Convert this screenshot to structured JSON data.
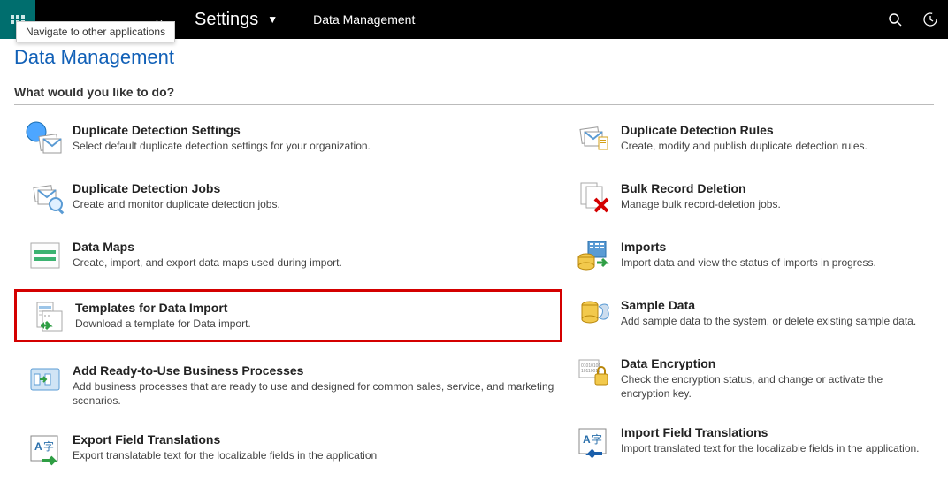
{
  "nav": {
    "tooltip": "Navigate to other applications",
    "settings": "Settings",
    "breadcrumb": "Data Management"
  },
  "page": {
    "title": "Data Management",
    "prompt": "What would you like to do?"
  },
  "left": [
    {
      "title": "Duplicate Detection Settings",
      "desc": "Select default duplicate detection settings for your organization."
    },
    {
      "title": "Duplicate Detection Jobs",
      "desc": "Create and monitor duplicate detection jobs."
    },
    {
      "title": "Data Maps",
      "desc": "Create, import, and export data maps used during import."
    },
    {
      "title": "Templates for Data Import",
      "desc": "Download a template for Data import.",
      "highlight": true
    },
    {
      "title": "Add Ready-to-Use Business Processes",
      "desc": "Add business processes that are ready to use and designed for common sales, service, and marketing scenarios."
    },
    {
      "title": "Export Field Translations",
      "desc": "Export translatable text for the localizable fields in the application"
    }
  ],
  "right": [
    {
      "title": "Duplicate Detection Rules",
      "desc": "Create, modify and publish duplicate detection rules."
    },
    {
      "title": "Bulk Record Deletion",
      "desc": "Manage bulk record-deletion jobs."
    },
    {
      "title": "Imports",
      "desc": "Import data and view the status of imports in progress."
    },
    {
      "title": "Sample Data",
      "desc": "Add sample data to the system, or delete existing sample data."
    },
    {
      "title": "Data Encryption",
      "desc": "Check the encryption status, and change or activate the encryption key."
    },
    {
      "title": "Import Field Translations",
      "desc": "Import translated text for the localizable fields in the application."
    }
  ]
}
